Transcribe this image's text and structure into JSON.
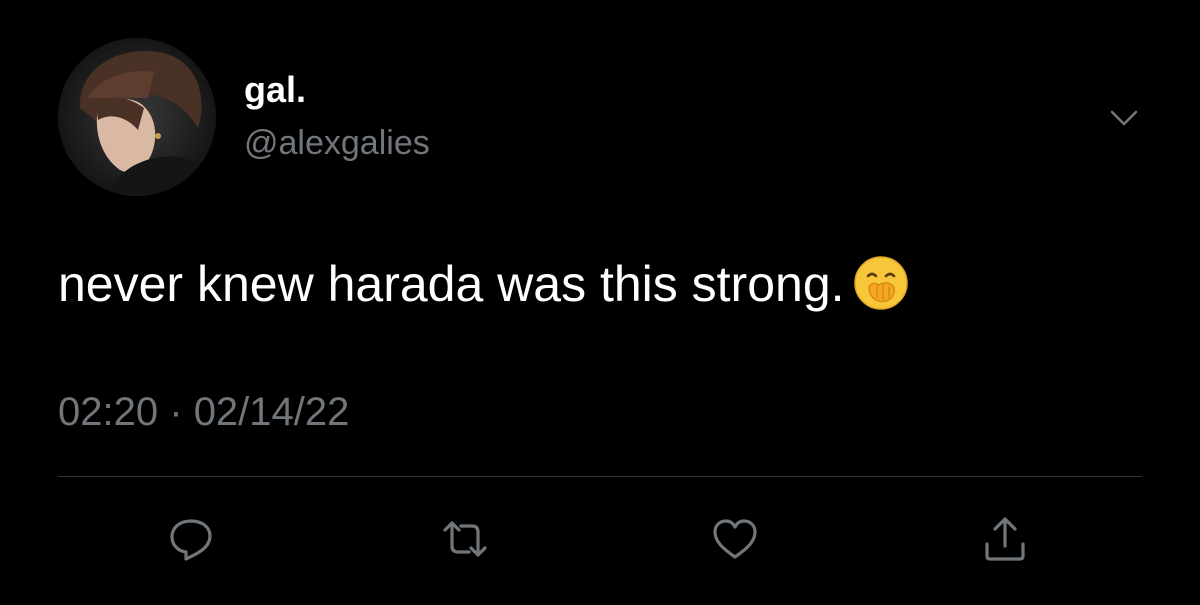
{
  "author": {
    "display_name": "gal.",
    "handle": "@alexgalies",
    "avatar_icon": "profile-photo"
  },
  "tweet": {
    "text": "never knew harada was this strong.",
    "emoji": "face-with-hand-over-mouth",
    "time": "02:20",
    "separator": "·",
    "date": "02/14/22"
  },
  "actions": [
    {
      "name": "reply",
      "icon": "speech-bubble-icon"
    },
    {
      "name": "retweet",
      "icon": "retweet-arrows-icon"
    },
    {
      "name": "like",
      "icon": "heart-icon"
    },
    {
      "name": "share",
      "icon": "share-upload-icon"
    }
  ],
  "colors": {
    "background": "#000000",
    "primary_text": "#ffffff",
    "secondary_text": "#71767b",
    "divider": "#2f3336"
  }
}
